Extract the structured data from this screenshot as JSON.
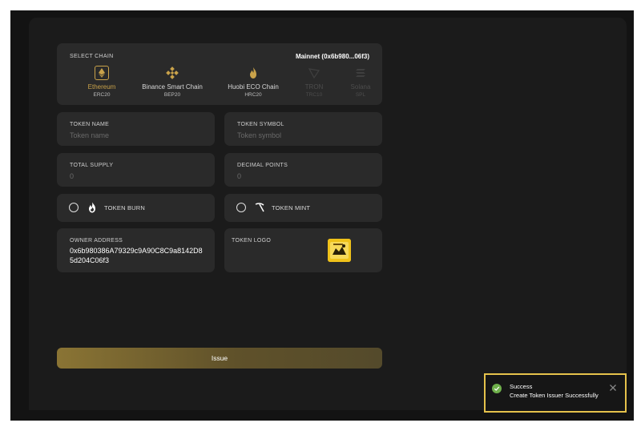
{
  "chain_select": {
    "label": "SELECT CHAIN",
    "network": "Mainnet",
    "wallet": "(0x6b980...06f3)",
    "chains": [
      {
        "name": "Ethereum",
        "standard": "ERC20",
        "icon": "ethereum-icon",
        "state": "selected"
      },
      {
        "name": "Binance Smart Chain",
        "standard": "BEP20",
        "icon": "binance-icon",
        "state": "enabled"
      },
      {
        "name": "Huobi ECO Chain",
        "standard": "HRC20",
        "icon": "huobi-flame-icon",
        "state": "enabled"
      },
      {
        "name": "TRON",
        "standard": "TRC10",
        "icon": "tron-icon",
        "state": "disabled"
      },
      {
        "name": "Solana",
        "standard": "SPL",
        "icon": "solana-icon",
        "state": "disabled"
      }
    ]
  },
  "token_name": {
    "label": "TOKEN NAME",
    "placeholder": "Token name"
  },
  "token_symbol": {
    "label": "TOKEN SYMBOL",
    "placeholder": "Token symbol"
  },
  "total_supply": {
    "label": "TOTAL SUPPLY",
    "placeholder": "0"
  },
  "decimal_points": {
    "label": "DECIMAL POINTS",
    "placeholder": "0"
  },
  "token_burn": {
    "label": "TOKEN BURN",
    "checked": false,
    "icon": "flame-icon"
  },
  "token_mint": {
    "label": "TOKEN MINT",
    "checked": false,
    "icon": "pickaxe-icon"
  },
  "owner_address": {
    "label": "OWNER ADDRESS",
    "value": "0x6b980386A79329c9A90C8C9a8142D85d204C06f3"
  },
  "token_logo": {
    "label": "TOKEN LOGO"
  },
  "issue_button": {
    "label": "Issue"
  },
  "toast": {
    "title": "Success",
    "message": "Create Token Issuer Successfully",
    "icon": "check-circle-icon"
  },
  "colors": {
    "accent_gold": "#c9a24a",
    "toast_border": "#e5c24b",
    "success_green": "#6fb04b"
  }
}
